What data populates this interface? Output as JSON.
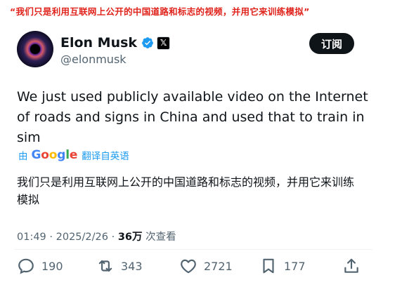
{
  "caption": "“我们只是利用互联网上公开的中国道路和标志的视频，并用它来训练模拟”",
  "author": {
    "name": "Elon Musk",
    "handle": "@elonmusk"
  },
  "subscribe_label": "订阅",
  "tweet": {
    "text": "We just used publicly available video on the Internet of roads and signs in China and used that to train in sim",
    "translated_by_prefix": "由",
    "translator_letters": [
      "G",
      "o",
      "o",
      "g",
      "l",
      "e"
    ],
    "translate_action": "翻译自英语",
    "translation": "我们只是利用互联网上公开的中国道路和标志的视频，并用它来训练模拟",
    "time": "01:49",
    "separator": " · ",
    "date": "2025/2/26",
    "views_count": "36万",
    "views_label": "次查看"
  },
  "actions": {
    "replies": "190",
    "reposts": "343",
    "likes": "2721",
    "bookmarks": "177"
  },
  "icons": {
    "verified": "verified-badge-icon",
    "x_logo": "x-logo-icon",
    "reply": "reply-icon",
    "repost": "repost-icon",
    "like": "heart-icon",
    "bookmark": "bookmark-icon",
    "share": "share-icon"
  },
  "colors": {
    "caption": "#e0231c",
    "verified": "#1d9bf0",
    "link": "#1d9bf0",
    "muted": "#536471",
    "subscribe_bg": "#0f1419"
  }
}
